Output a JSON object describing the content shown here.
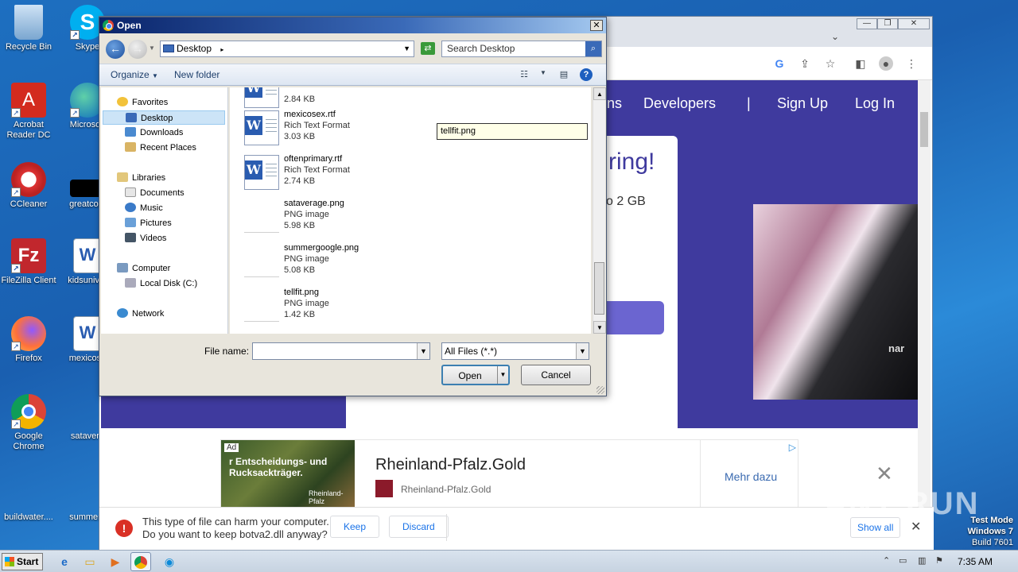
{
  "desktop": {
    "icons": [
      {
        "label": "Recycle Bin"
      },
      {
        "label": "Skype"
      },
      {
        "label": "Acrobat Reader DC"
      },
      {
        "label": "Microsoft"
      },
      {
        "label": "CCleaner"
      },
      {
        "label": "greatcom"
      },
      {
        "label": "FileZilla Client"
      },
      {
        "label": "kidsuniver"
      },
      {
        "label": "Firefox"
      },
      {
        "label": "mexicose"
      },
      {
        "label": "Google Chrome"
      },
      {
        "label": "satavera"
      },
      {
        "label": "buildwater...."
      },
      {
        "label": "summerg"
      }
    ]
  },
  "browser": {
    "nav_links": [
      "ns",
      "Developers",
      "|",
      "Sign Up",
      "Log In"
    ],
    "card_title": "ring!",
    "card_sub": "o 2 GB",
    "photo_text": "nar",
    "ad": {
      "badge": "Ad",
      "image_text": "r Entscheidungs- und Rucksackträger.",
      "image_small": "Rheinland-Pfalz",
      "title": "Rheinland-Pfalz.Gold",
      "subtitle": "Rheinland-Pfalz.Gold",
      "more": "Mehr dazu"
    },
    "download_bar": {
      "line1": "This type of file can harm your computer.",
      "line2": "Do you want to keep botva2.dll anyway?",
      "keep": "Keep",
      "discard": "Discard",
      "show_all": "Show all"
    }
  },
  "dialog": {
    "title": "Open",
    "address": "Desktop",
    "search_placeholder": "Search Desktop",
    "organize": "Organize",
    "new_folder": "New folder",
    "nav": {
      "favorites": "Favorites",
      "desktop": "Desktop",
      "downloads": "Downloads",
      "recent": "Recent Places",
      "libraries": "Libraries",
      "documents": "Documents",
      "music": "Music",
      "pictures": "Pictures",
      "videos": "Videos",
      "computer": "Computer",
      "local_disk": "Local Disk (C:)",
      "network": "Network"
    },
    "files": [
      {
        "name": "",
        "type": "",
        "size": "2.84 KB",
        "icon": "doc"
      },
      {
        "name": "mexicosex.rtf",
        "type": "Rich Text Format",
        "size": "3.03 KB",
        "icon": "doc"
      },
      {
        "name": "oftenprimary.rtf",
        "type": "Rich Text Format",
        "size": "2.74 KB",
        "icon": "doc"
      },
      {
        "name": "sataverage.png",
        "type": "PNG image",
        "size": "5.98 KB",
        "icon": "png"
      },
      {
        "name": "summergoogle.png",
        "type": "PNG image",
        "size": "5.08 KB",
        "icon": "png"
      },
      {
        "name": "tellfit.png",
        "type": "PNG image",
        "size": "1.42 KB",
        "icon": "png"
      }
    ],
    "rename_value": "tellfit.png",
    "file_name_label": "File name:",
    "file_name_value": "",
    "file_type": "All Files (*.*)",
    "open": "Open",
    "cancel": "Cancel"
  },
  "taskbar": {
    "start": "Start",
    "clock": "7:35 AM"
  },
  "os_watermark": {
    "line1": "Test Mode",
    "line2": "Windows 7",
    "line3": "Build 7601"
  },
  "anyrun": "ANY RUN"
}
